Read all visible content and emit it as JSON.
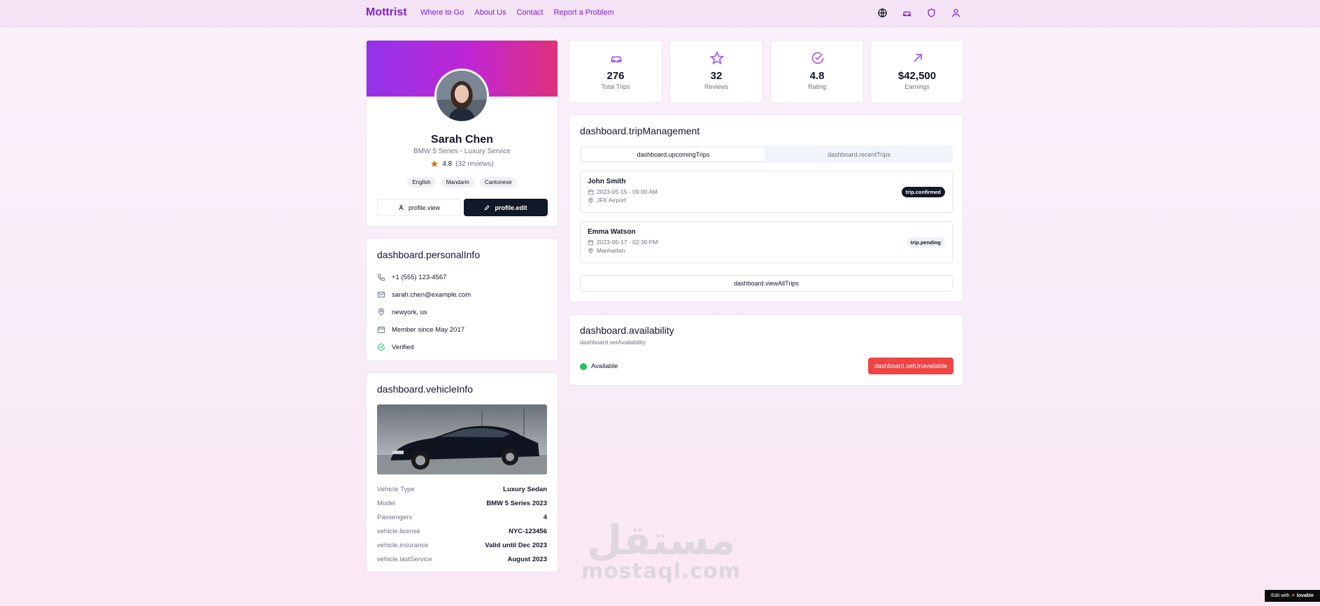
{
  "header": {
    "brand": "Mottrist",
    "nav": [
      "Where to Go",
      "About Us",
      "Contact",
      "Report a Problem"
    ],
    "icons": [
      "globe-icon",
      "car-icon",
      "shield-icon",
      "user-icon"
    ]
  },
  "profile": {
    "name": "Sarah Chen",
    "vehicle": "BMW 5 Series - Luxury Service",
    "rating": "4.8",
    "reviews": "(32 reviews)",
    "languages": [
      "English",
      "Mandarin",
      "Cantonese"
    ],
    "view_label": "profile.view",
    "edit_label": "profile.edit"
  },
  "personal_info": {
    "title": "dashboard.personalInfo",
    "phone": "+1 (555) 123-4567",
    "email": "sarah.chen@example.com",
    "location": "newyork, us",
    "member_since": "Member since May 2017",
    "verified": "Verified"
  },
  "vehicle_info": {
    "title": "dashboard.vehicleInfo",
    "rows": [
      {
        "key": "Vehicle Type",
        "value": "Luxury Sedan"
      },
      {
        "key": "Model",
        "value": "BMW 5 Series 2023"
      },
      {
        "key": "Passengers",
        "value": "4"
      },
      {
        "key": "vehicle.license",
        "value": "NYC-123456"
      },
      {
        "key": "vehicle.insurance",
        "value": "Valid until Dec 2023"
      },
      {
        "key": "vehicle.lastService",
        "value": "August 2023"
      }
    ]
  },
  "stats": [
    {
      "value": "276",
      "label": "Total Trips",
      "icon": "car-icon"
    },
    {
      "value": "32",
      "label": "Reviews",
      "icon": "star-icon"
    },
    {
      "value": "4.8",
      "label": "Rating",
      "icon": "check-circle-icon"
    },
    {
      "value": "$42,500",
      "label": "Earnings",
      "icon": "arrow-up-right-icon"
    }
  ],
  "trip_management": {
    "title": "dashboard.tripManagement",
    "tabs": [
      "dashboard.upcomingTrips",
      "dashboard.recentTrips"
    ],
    "trips": [
      {
        "name": "John Smith",
        "datetime": "2023-05-15 - 09:00 AM",
        "location": "JFK Airport",
        "status": "trip.confirmed"
      },
      {
        "name": "Emma Watson",
        "datetime": "2023-05-17 - 02:30 PM",
        "location": "Manhattan",
        "status": "trip.pending"
      }
    ],
    "view_all": "dashboard.viewAllTrips"
  },
  "availability": {
    "title": "dashboard.availability",
    "subtitle": "dashboard.setAvailability",
    "status": "Available",
    "button": "dashboard.setUnavailable"
  },
  "watermark": {
    "arabic": "مستقل",
    "latin": "mostaql.com"
  },
  "badge": {
    "text": "Edit with",
    "brand": "lovable"
  },
  "colors": {
    "accent": "#7e22ce",
    "primary_dark": "#111827",
    "danger": "#ef4444",
    "success": "#22c55e",
    "rating_star": "#d97706"
  }
}
